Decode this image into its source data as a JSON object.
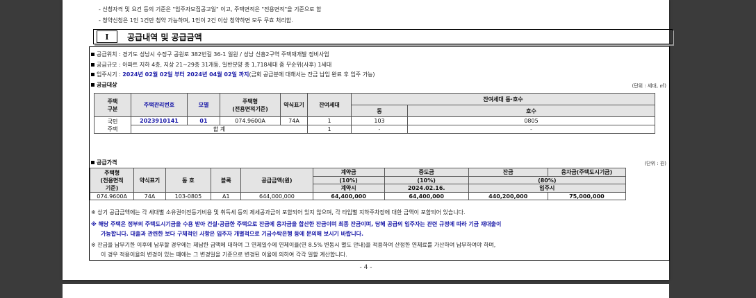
{
  "notes": {
    "line1": "- 신청자격 및 요건 등의 기준은 \"입주자모집공고일\" 이고, 주택면적은 \"전용면적\"을 기준으로 함",
    "line2": "- 청약신청은 1인 1건만 청약 가능하며, 1인이 2건 이상 청약하면 모두 무효 처리함."
  },
  "section": {
    "num": "I",
    "title": "공급내역 및 공급금액"
  },
  "info": {
    "location": "공급위치 : 경기도 성남시 수정구 공원로 382번길 36-1 일원 / 성남 신흥2구역 주택재개발 정비사업",
    "scale": "공급규모 : 아파트 지하 4층, 지상 21~29층 31개동, 일반분양 총 1,718세대 중 무순위(사후) 1세대",
    "move_in_prefix": "입주시기 : ",
    "move_in_highlight": "2024년 02월 02일 부터 2024년 04월 02일 까지",
    "move_in_suffix": "(금회 공급분에 대해서는 잔금 납입 완료 후 입주 가능)"
  },
  "target": {
    "title": "공급대상",
    "unit": "(단위 : 세대, ㎡)",
    "headers": {
      "house_type": "주택\n구분",
      "mgmt_no": "주택관리번호",
      "model": "모델",
      "area": "주택형\n(전용면적기준)",
      "short": "약식표기",
      "remaining": "잔여세대",
      "group": "잔여세대 동·호수",
      "dong": "동",
      "ho": "호수"
    },
    "house_type_value": "국민\n주택",
    "row": {
      "mgmt_no": "2023910141",
      "model": "01",
      "area": "074.9600A",
      "short": "74A",
      "remaining": "1",
      "dong": "103",
      "ho": "0805"
    },
    "total": {
      "label": "합 계",
      "remaining": "1",
      "dong": "-",
      "ho": "-"
    }
  },
  "price": {
    "title": "공급가격",
    "unit": "(단위 : 원)",
    "headers": {
      "area": "주택형\n(전용면적\n기준)",
      "short": "약식표기",
      "dongho": "동 호",
      "block": "블록",
      "amount": "공급금액(원)",
      "deposit": "계약금",
      "middle": "중도금",
      "balance": "잔금",
      "loan": "융자금(주택도시기금)",
      "deposit_pct": "(10%)",
      "middle_pct": "(10%)",
      "balance_pct": "(80%)",
      "deposit_when": "계약시",
      "middle_when": "2024.02.16.",
      "balance_when": "입주시"
    },
    "row": {
      "area": "074.9600A",
      "short": "74A",
      "dongho": "103-0805",
      "block": "A1",
      "amount": "644,000,000",
      "deposit": "64,400,000",
      "middle": "64,400,000",
      "balance": "440,200,000",
      "loan": "75,000,000"
    }
  },
  "footnotes": {
    "f1": "※ 상기 공급금액에는 각 세대별 소유권이전등기비용 및 취득세 등의 제세공과금이 포함되어 있지 않으며, 각 타입별 지하주차장에 대한 금액이 포함되어 있습니다.",
    "f2a": "※ 해당 주택은 정부의 주택도시기금을 수용 받아 건설·공급한 주택으로 잔금에 융자금을 합산한 잔금이며 최종 잔금이며, 당해 공급의 입주자는 관련 규정에 따라 기금 재대출이",
    "f2b": "가능합니다. 대출과 관련한 보다 구체적인 사항은 입주자 개별적으로 기금수탁은행 등에 문의해 보시기 바랍니다.",
    "f3a": "※ 잔금을 납부기한 이후에 납부할 경우에는 체납한 금액에 대하여 그 연체일수에 연체이율(연 8.5% 변동시 별도 안내)을 적용하여 산정한 연체료를 가산하여 납부하여야 하며,",
    "f3b": "이 경우 적용이율의 변경이 있는 때에는 그 변경일을 기준으로 변경된 이율에 의하여 각각 일할 계산합니다."
  },
  "page_number": "- 4 -"
}
